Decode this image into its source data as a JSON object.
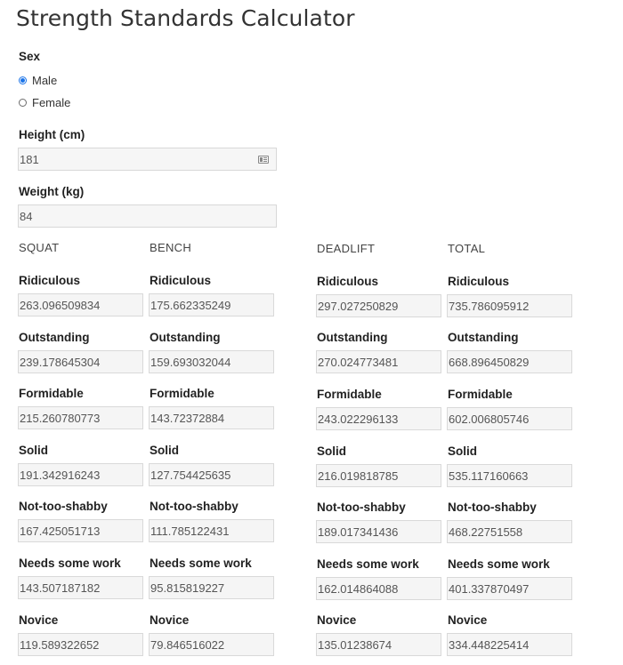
{
  "title": "Strength Standards Calculator",
  "sex": {
    "label": "Sex",
    "options": [
      "Male",
      "Female"
    ],
    "selected": "Male"
  },
  "height": {
    "label": "Height (cm)",
    "value": "181"
  },
  "weight": {
    "label": "Weight (kg)",
    "value": "84"
  },
  "columns": [
    {
      "header": "SQUAT",
      "rows": [
        {
          "label": "Ridiculous",
          "value": "263.096509834"
        },
        {
          "label": "Outstanding",
          "value": "239.178645304"
        },
        {
          "label": "Formidable",
          "value": "215.260780773"
        },
        {
          "label": "Solid",
          "value": "191.342916243"
        },
        {
          "label": "Not-too-shabby",
          "value": "167.425051713"
        },
        {
          "label": "Needs some work",
          "value": "143.507187182"
        },
        {
          "label": "Novice",
          "value": "119.589322652"
        }
      ]
    },
    {
      "header": "BENCH",
      "rows": [
        {
          "label": "Ridiculous",
          "value": "175.662335249"
        },
        {
          "label": "Outstanding",
          "value": "159.693032044"
        },
        {
          "label": "Formidable",
          "value": "143.72372884"
        },
        {
          "label": "Solid",
          "value": "127.754425635"
        },
        {
          "label": "Not-too-shabby",
          "value": "111.785122431"
        },
        {
          "label": "Needs some work",
          "value": "95.815819227"
        },
        {
          "label": "Novice",
          "value": "79.846516022"
        }
      ]
    },
    {
      "header": "DEADLIFT",
      "rows": [
        {
          "label": "Ridiculous",
          "value": "297.027250829"
        },
        {
          "label": "Outstanding",
          "value": "270.024773481"
        },
        {
          "label": "Formidable",
          "value": "243.022296133"
        },
        {
          "label": "Solid",
          "value": "216.019818785"
        },
        {
          "label": "Not-too-shabby",
          "value": "189.017341436"
        },
        {
          "label": "Needs some work",
          "value": "162.014864088"
        },
        {
          "label": "Novice",
          "value": "135.01238674"
        }
      ]
    },
    {
      "header": "TOTAL",
      "rows": [
        {
          "label": "Ridiculous",
          "value": "735.786095912"
        },
        {
          "label": "Outstanding",
          "value": "668.896450829"
        },
        {
          "label": "Formidable",
          "value": "602.006805746"
        },
        {
          "label": "Solid",
          "value": "535.117160663"
        },
        {
          "label": "Not-too-shabby",
          "value": "468.22751558"
        },
        {
          "label": "Needs some work",
          "value": "401.337870497"
        },
        {
          "label": "Novice",
          "value": "334.448225414"
        }
      ]
    }
  ],
  "accent_color": "#1a73e8",
  "icons": {
    "height_field": "contact-card-icon"
  }
}
